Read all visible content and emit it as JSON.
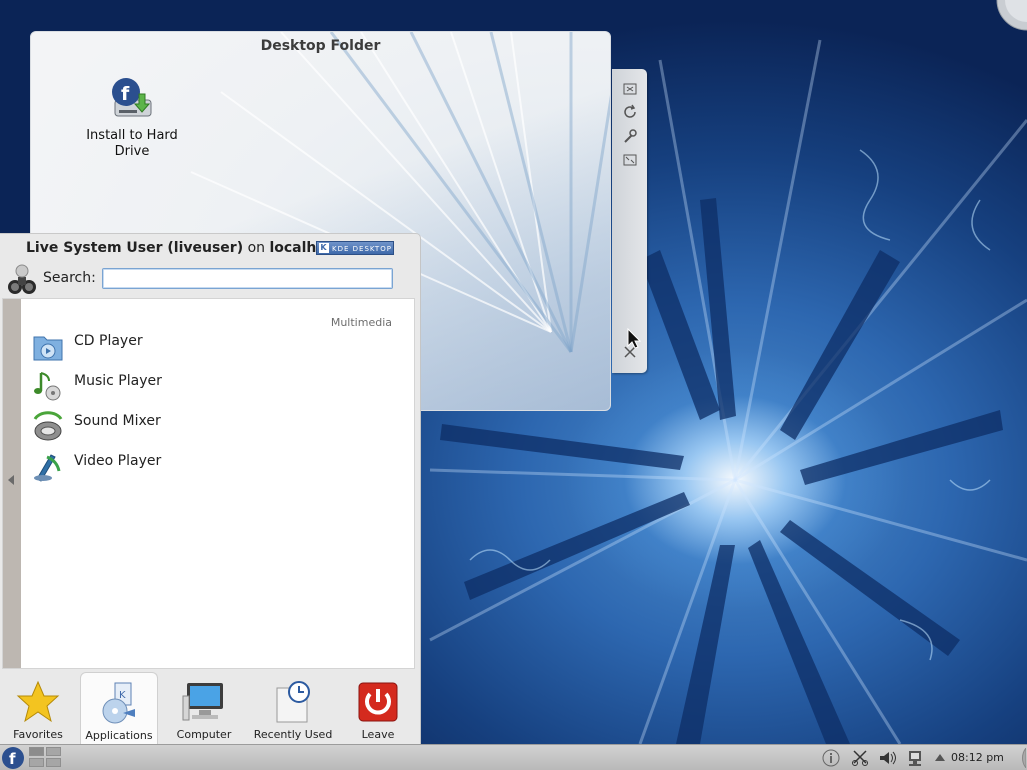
{
  "desktop": {
    "folder": {
      "title": "Desktop Folder",
      "icons": [
        {
          "label": "Install to Hard Drive",
          "icon": "fedora-install-icon"
        }
      ],
      "toolbox": [
        "maximize-icon",
        "rotate-icon",
        "configure-wrench-icon",
        "resize-icon",
        "close-icon"
      ]
    }
  },
  "kickoff": {
    "header": {
      "user": "Live System User (liveuser)",
      "on": "on",
      "host": "localh",
      "badge": "KDE DESKTOP"
    },
    "search": {
      "label": "Search:",
      "value": "",
      "placeholder": ""
    },
    "group": "Multimedia",
    "apps": [
      {
        "label": "CD Player",
        "icon": "cd-player-icon"
      },
      {
        "label": "Music Player",
        "icon": "music-player-icon"
      },
      {
        "label": "Sound Mixer",
        "icon": "sound-mixer-icon"
      },
      {
        "label": "Video Player",
        "icon": "video-player-icon"
      }
    ],
    "tabs": [
      {
        "label": "Favorites",
        "icon": "star-icon"
      },
      {
        "label": "Applications",
        "icon": "applications-icon",
        "active": true
      },
      {
        "label": "Computer",
        "icon": "computer-icon"
      },
      {
        "label": "Recently Used",
        "icon": "recent-clock-icon"
      },
      {
        "label": "Leave",
        "icon": "power-icon"
      }
    ]
  },
  "panel": {
    "clock": "08:12 pm",
    "tray": [
      "info-icon",
      "scissors-icon",
      "volume-icon",
      "network-icon"
    ]
  }
}
